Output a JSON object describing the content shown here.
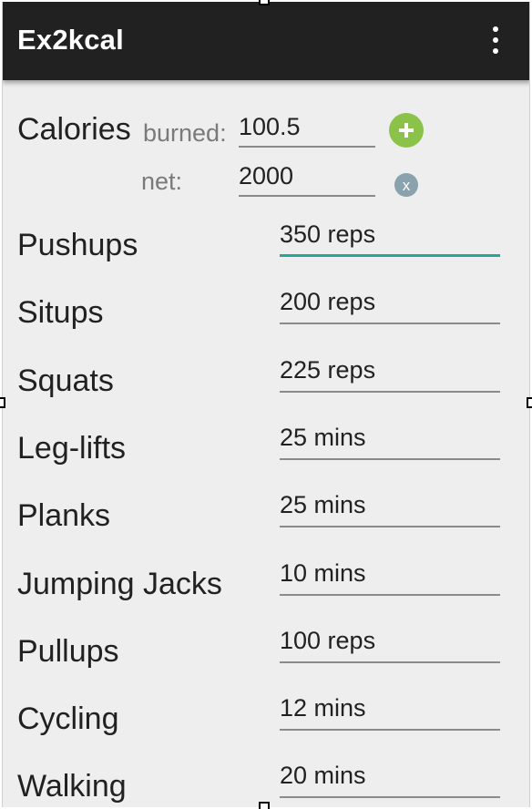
{
  "app": {
    "title": "Ex2kcal",
    "menu_icon": "overflow-menu-icon"
  },
  "calories": {
    "label": "Calories",
    "burned_label": "burned:",
    "burned_value": "100.5",
    "net_label": "net:",
    "net_value": "2000",
    "add_icon": "plus-circle-icon",
    "add_color": "#8bc34a",
    "clear_icon": "clear-circle-icon",
    "clear_glyph": "x",
    "clear_color": "#8aa1ae"
  },
  "exercises": [
    {
      "label": "Pushups",
      "value": "350 reps"
    },
    {
      "label": "Situps",
      "value": "200 reps"
    },
    {
      "label": "Squats",
      "value": "225 reps"
    },
    {
      "label": "Leg-lifts",
      "value": "25 mins"
    },
    {
      "label": "Planks",
      "value": "25 mins"
    },
    {
      "label": "Jumping Jacks",
      "value": "10 mins"
    },
    {
      "label": "Pullups",
      "value": "100 reps"
    },
    {
      "label": "Cycling",
      "value": "12 mins"
    },
    {
      "label": "Walking",
      "value": "20 mins"
    }
  ],
  "colors": {
    "appbar": "#212121",
    "background": "#eeeeee",
    "focus_underline": "#26a69a"
  }
}
